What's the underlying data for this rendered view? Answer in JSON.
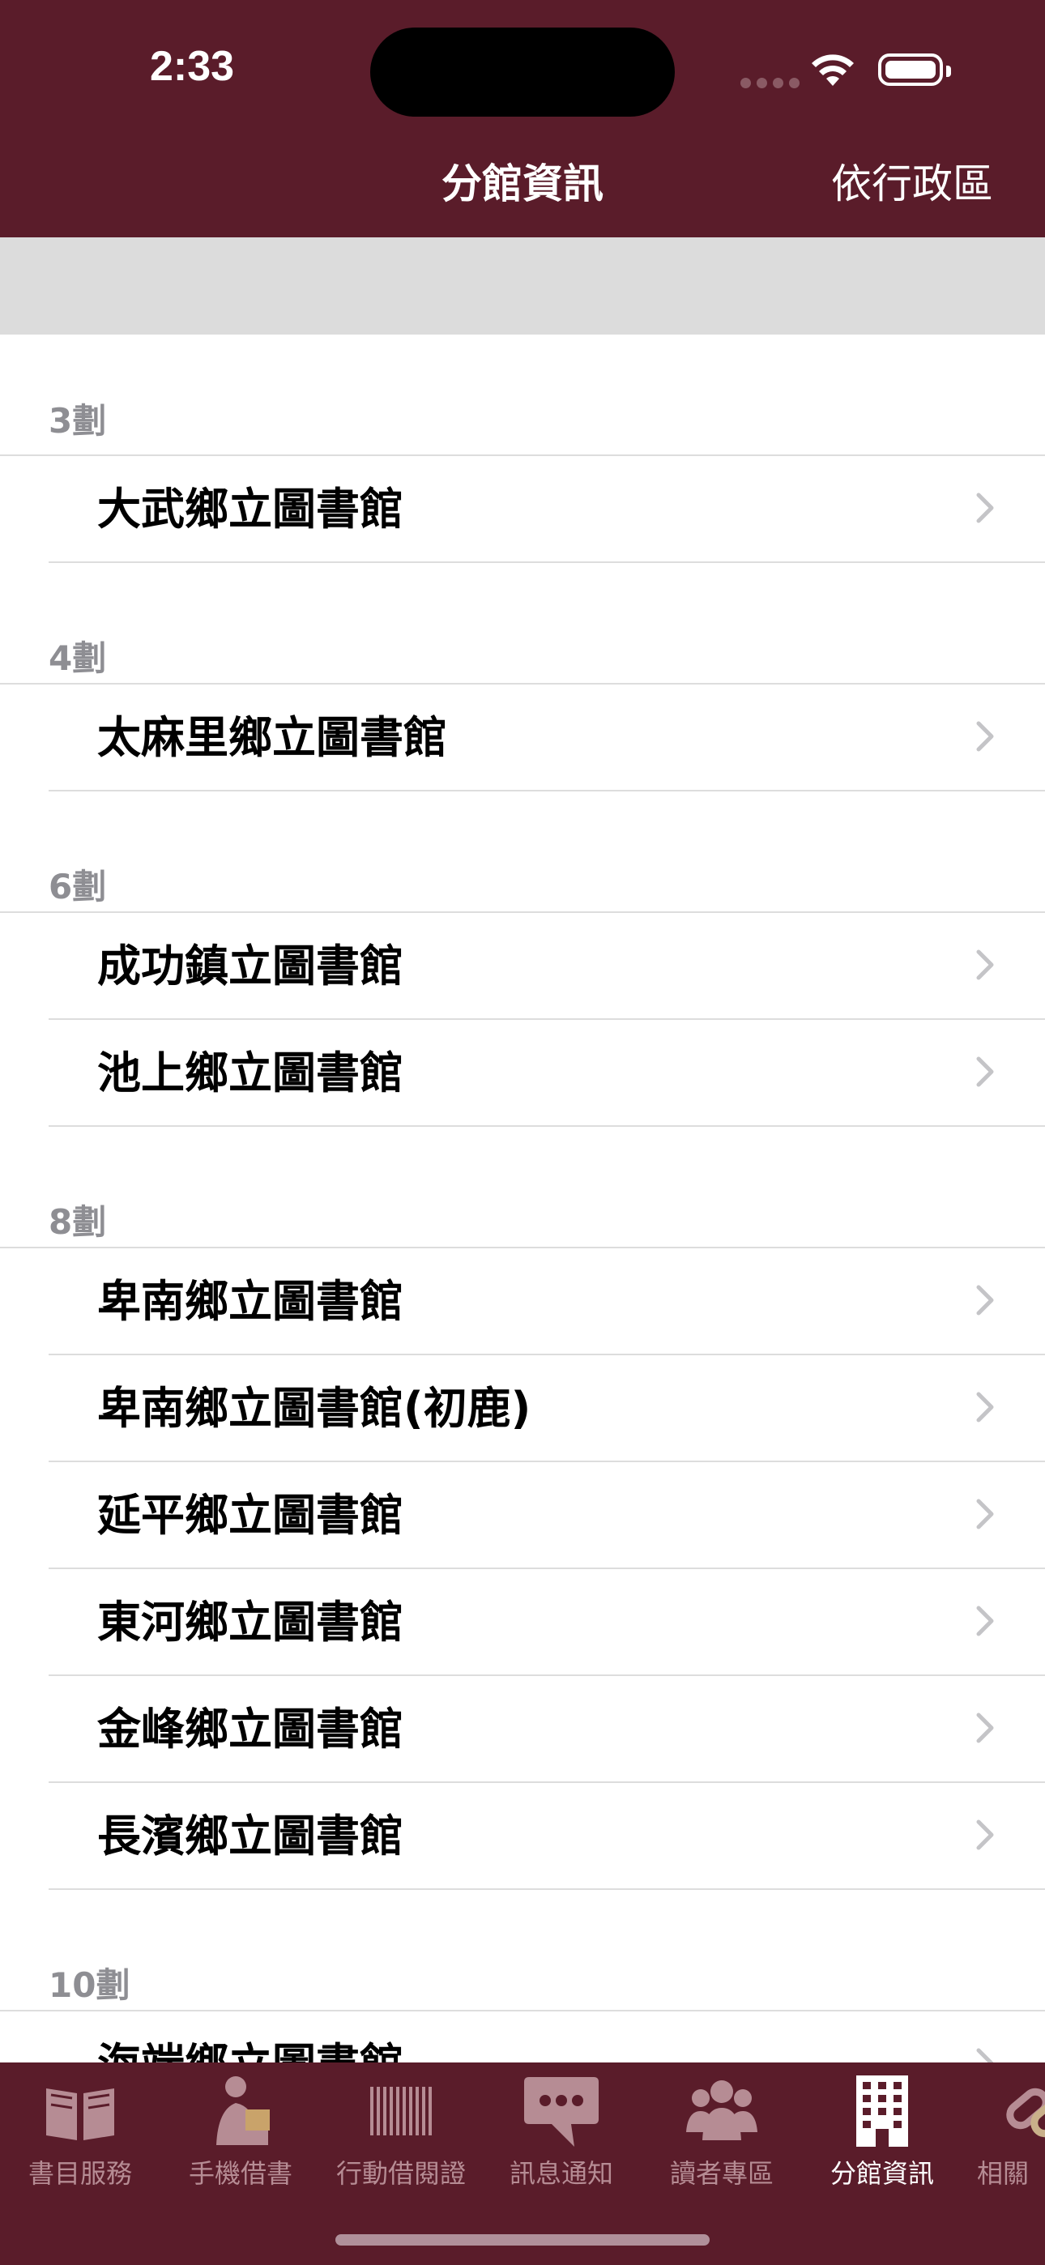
{
  "status_bar": {
    "time": "2:33"
  },
  "nav": {
    "title": "分館資訊",
    "right_button": "依行政區"
  },
  "sections": [
    {
      "header": "3劃",
      "rows": [
        "大武鄉立圖書館"
      ]
    },
    {
      "header": "4劃",
      "rows": [
        "太麻里鄉立圖書館"
      ]
    },
    {
      "header": "6劃",
      "rows": [
        "成功鎮立圖書館",
        "池上鄉立圖書館"
      ]
    },
    {
      "header": "8劃",
      "rows": [
        "卑南鄉立圖書館",
        "卑南鄉立圖書館(初鹿)",
        "延平鄉立圖書館",
        "東河鄉立圖書館",
        "金峰鄉立圖書館",
        "長濱鄉立圖書館"
      ]
    },
    {
      "header": "10劃",
      "rows": [
        "海端鄉立圖書館"
      ]
    }
  ],
  "tabbar": {
    "items": [
      {
        "label": "書目服務",
        "icon": "book-icon"
      },
      {
        "label": "手機借書",
        "icon": "reader-icon"
      },
      {
        "label": "行動借閱證",
        "icon": "barcode-icon"
      },
      {
        "label": "訊息通知",
        "icon": "chat-bubble-icon"
      },
      {
        "label": "讀者專區",
        "icon": "people-icon"
      },
      {
        "label": "分館資訊",
        "icon": "building-icon"
      },
      {
        "label": "相關",
        "icon": "link-icon"
      }
    ]
  },
  "colors": {
    "brand": "#5a1c2a",
    "tab_inactive": "#b68c94",
    "section_header": "#8e8e93"
  }
}
